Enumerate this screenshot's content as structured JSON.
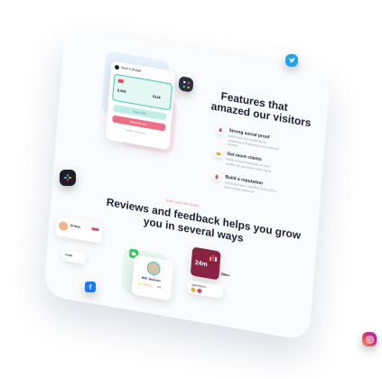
{
  "features": {
    "title_line1": "Features that",
    "title_line2": "amazed our visitors",
    "items": [
      {
        "title": "Strong social proof",
        "desc": "Build trust and credibility by collecting & displaying your customer reviews"
      },
      {
        "title": "Get more clients",
        "desc": "More positive feedback on your profile can generate more clients"
      },
      {
        "title": "Build a reputation",
        "desc": "Showcase your credibility and build a good online presence"
      }
    ]
  },
  "widget": {
    "header": "Send a Widget",
    "value_left": "8.94k",
    "value_right": "27.98",
    "value_right2": "$14k",
    "btn1": "Copy Code",
    "btn2": "Share Review",
    "link": "Share to anyone"
  },
  "reviews": {
    "tag": "OUR LAST REVIEWS",
    "title_line1": "Reviews and feedback helps you grow",
    "title_line2": "you in several ways"
  },
  "review_card": {
    "name": "Will Jackson",
    "rating": "4.9",
    "stars": "★★★★★"
  },
  "stat_card": {
    "value": "24m",
    "label": "28m+",
    "sub": "Applications"
  },
  "small_card": {
    "name": "Sriram"
  },
  "sms_card": {
    "name": "Grant"
  },
  "colors": {
    "accent": "#e8455f",
    "teal": "#3fc7b5",
    "dark": "#1c2035",
    "maroon": "#8a2244"
  }
}
